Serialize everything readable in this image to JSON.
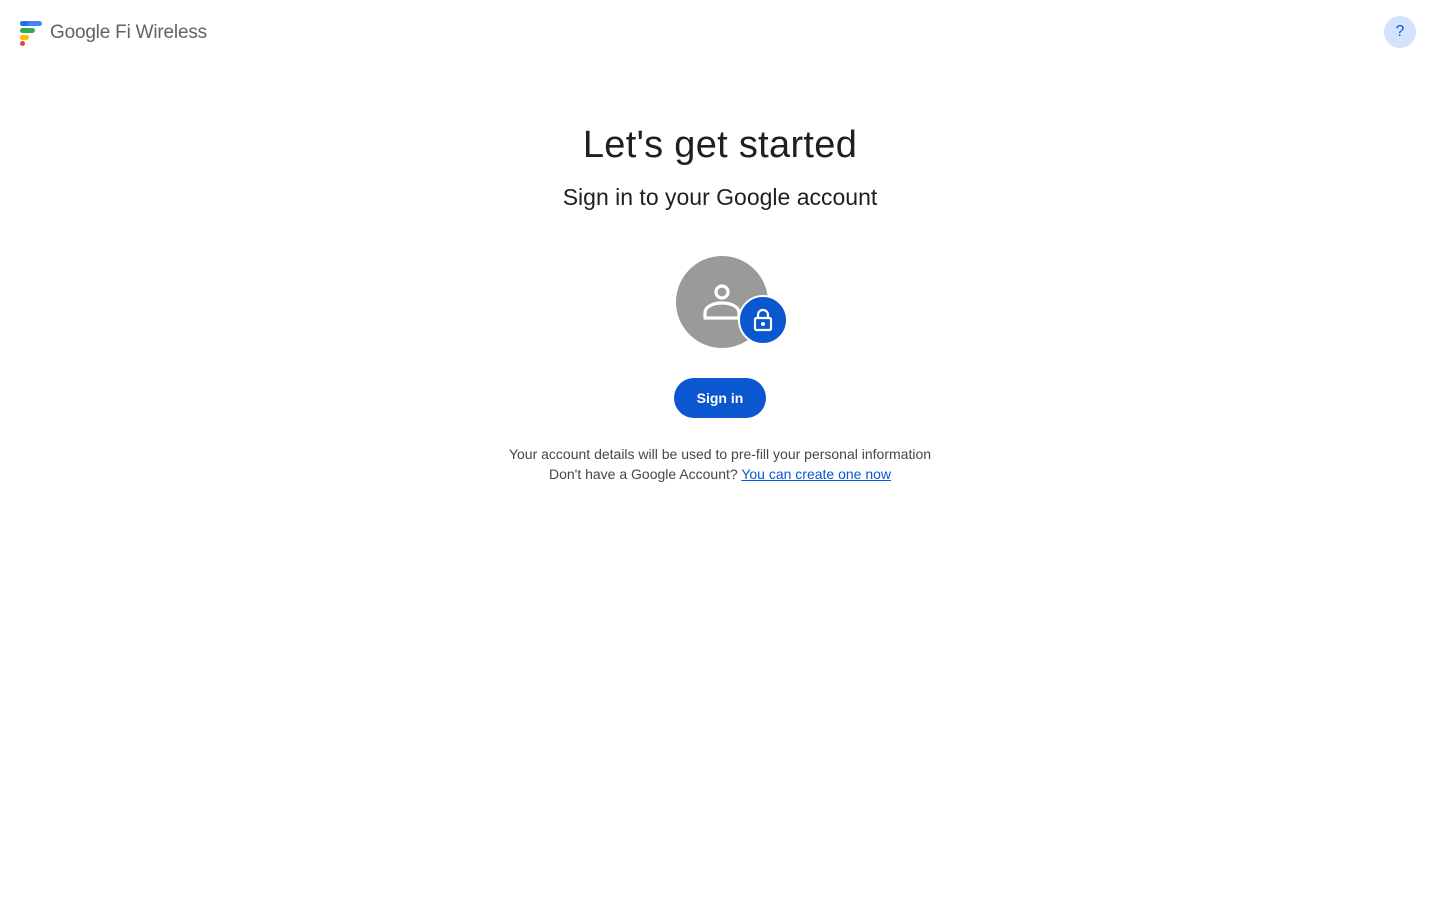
{
  "header": {
    "brand_google": "Google",
    "brand_product": "Fi Wireless",
    "help_label": "?",
    "logo_icon": "google-fi-logo-icon",
    "help_icon": "question-mark-icon"
  },
  "main": {
    "title": "Let's get started",
    "subtitle": "Sign in to your Google account",
    "avatar_icon": "person-icon",
    "badge_icon": "lock-icon",
    "signin_label": "Sign in",
    "info_text": "Your account details will be used to pre-fill your personal information",
    "create_prefix": "Don't have a Google Account?",
    "create_link": "You can create one now"
  },
  "colors": {
    "primary": "#0b57d0",
    "help_bg": "#d3e3fd",
    "avatar_bg": "#9a9a9a",
    "text": "#1f1f1f",
    "secondary_text": "#444746"
  }
}
